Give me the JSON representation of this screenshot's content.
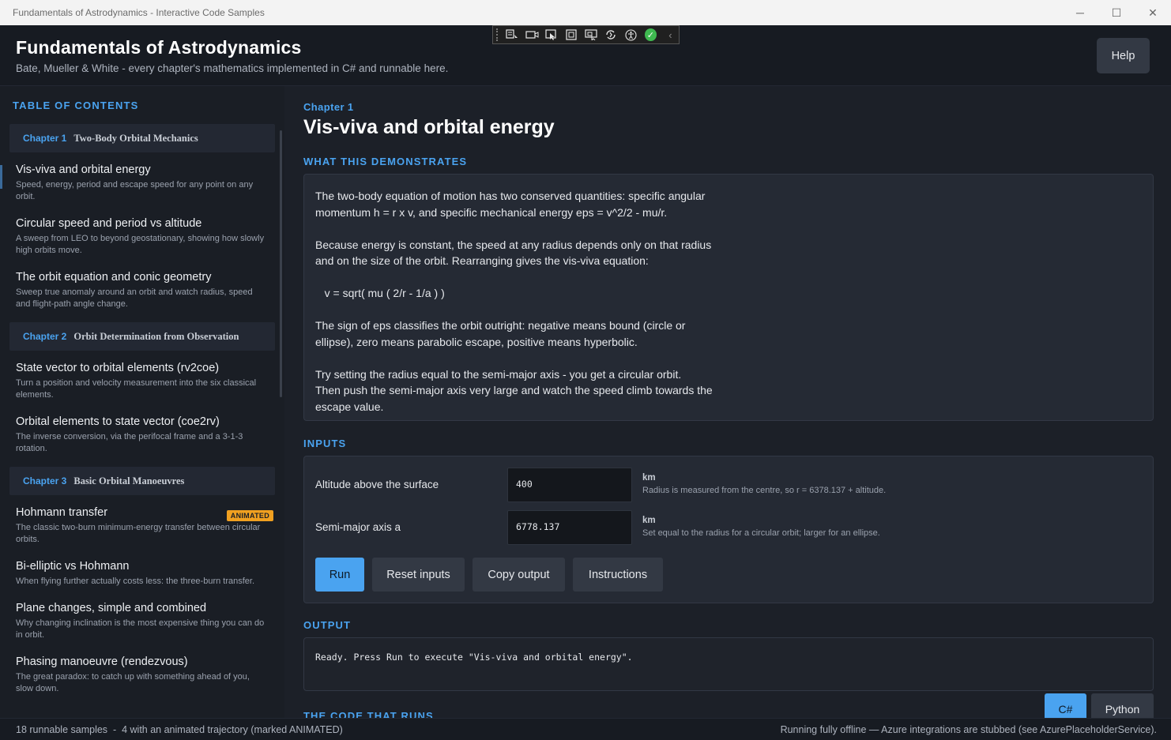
{
  "window": {
    "title": "Fundamentals of Astrodynamics - Interactive Code Samples",
    "minimize_glyph": "─",
    "maximize_glyph": "☐",
    "close_glyph": "✕"
  },
  "header": {
    "title": "Fundamentals of Astrodynamics",
    "subtitle": "Bate, Mueller & White - every chapter's mathematics implemented in C# and runnable here.",
    "help_label": "Help"
  },
  "debug_toolbar": {
    "icons": [
      "live-visual-tree-icon",
      "camera-icon",
      "select-element-icon",
      "display-layout-adorners-icon",
      "track-focus-icon",
      "hot-reload-icon",
      "accessibility-icon",
      "checkmark-icon",
      "collapse-chevron-icon"
    ]
  },
  "sidebar": {
    "heading": "TABLE OF CONTENTS",
    "chapters": [
      {
        "num": "Chapter 1",
        "name": "Two-Body Orbital Mechanics",
        "items": [
          {
            "title": "Vis-viva and orbital energy",
            "desc": "Speed, energy, period and escape speed for any point on any orbit."
          },
          {
            "title": "Circular speed and period vs altitude",
            "desc": "A sweep from LEO to beyond geostationary, showing how slowly high orbits move."
          },
          {
            "title": "The orbit equation and conic geometry",
            "desc": "Sweep true anomaly around an orbit and watch radius, speed and flight-path angle change."
          }
        ]
      },
      {
        "num": "Chapter 2",
        "name": "Orbit Determination from Observation",
        "items": [
          {
            "title": "State vector to orbital elements (rv2coe)",
            "desc": "Turn a position and velocity measurement into the six classical elements."
          },
          {
            "title": "Orbital elements to state vector (coe2rv)",
            "desc": "The inverse conversion, via the perifocal frame and a 3-1-3 rotation."
          }
        ]
      },
      {
        "num": "Chapter 3",
        "name": "Basic Orbital Manoeuvres",
        "items": [
          {
            "title": "Hohmann transfer",
            "desc": "The classic two-burn minimum-energy transfer between circular orbits.",
            "badge": "ANIMATED"
          },
          {
            "title": "Bi-elliptic vs Hohmann",
            "desc": "When flying further actually costs less: the three-burn transfer."
          },
          {
            "title": "Plane changes, simple and combined",
            "desc": "Why changing inclination is the most expensive thing you can do in orbit."
          },
          {
            "title": "Phasing manoeuvre (rendezvous)",
            "desc": "The great paradox: to catch up with something ahead of you, slow down."
          }
        ]
      }
    ]
  },
  "main": {
    "chapter_label": "Chapter 1",
    "title": "Vis-viva and orbital energy",
    "demo_heading": "WHAT THIS DEMONSTRATES",
    "demo_text": "The two-body equation of motion has two conserved quantities: specific angular\nmomentum h = r x v, and specific mechanical energy eps = v^2/2 - mu/r.\n\nBecause energy is constant, the speed at any radius depends only on that radius\nand on the size of the orbit. Rearranging gives the vis-viva equation:\n\n   v = sqrt( mu ( 2/r - 1/a ) )\n\nThe sign of eps classifies the orbit outright: negative means bound (circle or\nellipse), zero means parabolic escape, positive means hyperbolic.\n\nTry setting the radius equal to the semi-major axis - you get a circular orbit.\nThen push the semi-major axis very large and watch the speed climb towards the\nescape value.",
    "inputs_heading": "INPUTS",
    "inputs": [
      {
        "label": "Altitude above the surface",
        "value": "400",
        "unit": "km",
        "hint": "Radius is measured from the centre, so r = 6378.137 + altitude."
      },
      {
        "label": "Semi-major axis a",
        "value": "6778.137",
        "unit": "km",
        "hint": "Set equal to the radius for a circular orbit; larger for an ellipse."
      }
    ],
    "buttons": {
      "run": "Run",
      "reset": "Reset inputs",
      "copy": "Copy output",
      "instructions": "Instructions"
    },
    "output_heading": "OUTPUT",
    "output_text": "Ready. Press Run to execute \"Vis-viva and orbital energy\".",
    "code_heading": "THE CODE THAT RUNS",
    "lang_tabs": {
      "csharp": "C#",
      "python": "Python"
    }
  },
  "statusbar": {
    "left": "18 runnable samples  -  4 with an animated trajectory (marked ANIMATED)",
    "right": "Running fully offline — Azure integrations are stubbed (see AzurePlaceholderService)."
  }
}
